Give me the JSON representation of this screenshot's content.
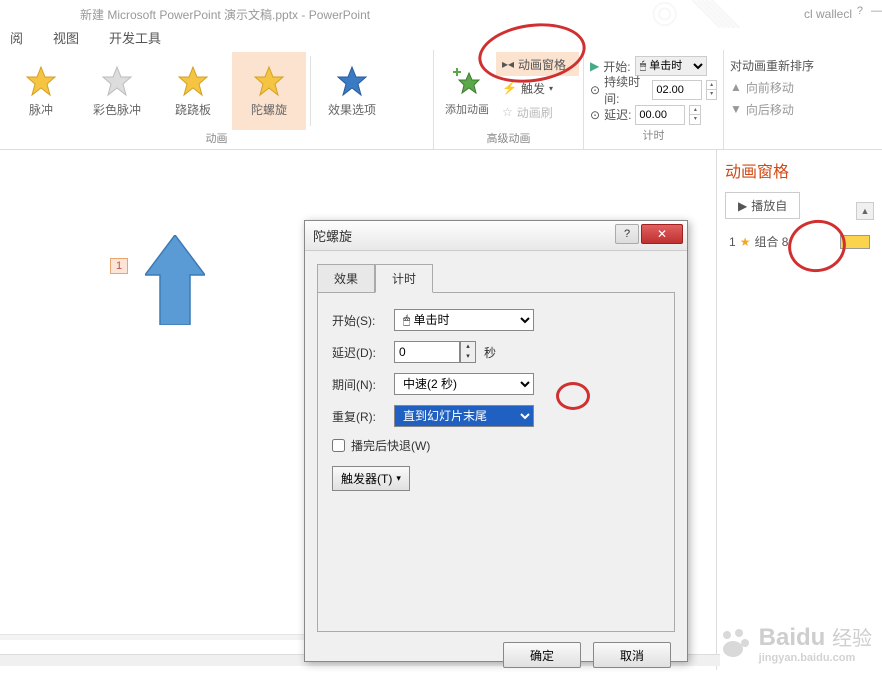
{
  "title": "新建 Microsoft PowerPoint 演示文稿.pptx - PowerPoint",
  "user": "cl wallecl",
  "menu": {
    "read": "阅",
    "view": "视图",
    "dev": "开发工具"
  },
  "ribbon": {
    "anim_group": "动画",
    "btn_pulse": "脉冲",
    "btn_colorpulse": "彩色脉冲",
    "btn_teeter": "跷跷板",
    "btn_spin": "陀螺旋",
    "btn_effectopts": "效果选项",
    "adv_group": "高级动画",
    "btn_add": "添加动画",
    "btn_pane": "动画窗格",
    "btn_trigger": "触发",
    "btn_painter": "动画刷",
    "timing_group": "计时",
    "lbl_start": "开始:",
    "val_start": "单击时",
    "lbl_duration": "持续时间:",
    "val_duration": "02.00",
    "lbl_delay": "延迟:",
    "val_delay": "00.00",
    "reorder_title": "对动画重新排序",
    "btn_forward": "向前移动",
    "btn_backward": "向后移动"
  },
  "slide": {
    "badge": "1"
  },
  "pane": {
    "title": "动画窗格",
    "play": "播放自",
    "item_index": "1",
    "item_label": "组合 8"
  },
  "dialog": {
    "title": "陀螺旋",
    "tab_effect": "效果",
    "tab_timing": "计时",
    "lbl_start": "开始(S):",
    "val_start": "单击时",
    "lbl_delay": "延迟(D):",
    "val_delay": "0",
    "unit_sec": "秒",
    "lbl_duration": "期间(N):",
    "val_duration": "中速(2 秒)",
    "lbl_repeat": "重复(R):",
    "val_repeat": "直到幻灯片末尾",
    "chk_rewind": "播完后快退(W)",
    "btn_trigger": "触发器(T)",
    "btn_ok": "确定",
    "btn_cancel": "取消"
  },
  "watermark": {
    "brand": "Baidu",
    "sub": "经验",
    "url": "jingyan.baidu.com"
  }
}
